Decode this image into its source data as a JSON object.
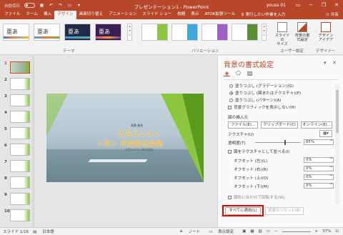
{
  "title_bar": {
    "autosave": "自動保存",
    "autosave_state": "オフ",
    "doc_title": "プレゼンテーション1 - PowerPoint",
    "user": "yousa 01"
  },
  "tabs": {
    "items": [
      "ファイル",
      "ホーム",
      "挿入",
      "デザイン",
      "画面切り替え",
      "アニメーション",
      "スライド ショー",
      "校閲",
      "表示",
      "ATOK拡張ツール"
    ],
    "active": "デザイン",
    "search": "実行したい作業を入力",
    "share": "共有"
  },
  "ribbon": {
    "themes": [
      "亜あ",
      "亜あ",
      "亜あ",
      "亜あ"
    ],
    "group_theme": "テーマ",
    "group_variation": "バリエーション",
    "group_user": "ユーザー設定",
    "group_designer": "デザイナー",
    "btn_slide_size": "スライドの\nサイズ",
    "btn_bg_format": "背景の書\n式設定",
    "btn_design_idea": "デザイン\nアイデア"
  },
  "thumbnails": {
    "numbers": [
      "1",
      "2",
      "3",
      "4",
      "5",
      "6",
      "7",
      "8",
      "9",
      "10"
    ],
    "selected": "1"
  },
  "slide": {
    "title1": "大宮ユニオン",
    "title2": "＜年＞ 年度販売提案",
    "sub1": "発表 者名",
    "sub2": "大宮ユニオン株式会社"
  },
  "pane": {
    "title": "背景の書式設定",
    "opt_gradient": "塗りつぶし (グラデーション)(G)",
    "opt_picture": "塗りつぶし (図またはテクスチャ)(P)",
    "opt_pattern": "塗りつぶし (パターン)(A)",
    "chk_hide": "背景グラフィックを表示しない(H)",
    "insert_label": "図の挿入元",
    "btn_file": "ファイル(E)...",
    "btn_clip": "クリップボード(C)",
    "btn_online": "オンライン(E)...",
    "texture_label": "テクスチャ(U)",
    "transparency_label": "透明度(T)",
    "transparency_value": "65%",
    "transparency_fraction": 0.65,
    "chk_tile": "図をテクスチャとして並べる(I)",
    "offset_left": "オフセット (左)(L)",
    "offset_right": "オフセット (右)(R)",
    "offset_top": "オフセット (上)(O)",
    "offset_bottom": "オフセット (下)(M)",
    "offset_value": "0%",
    "chk_rotate": "図形に合わせて回転する(W)",
    "btn_apply_all": "すべてに適用(L)",
    "btn_reset": "背景のリセット(B)"
  },
  "status": {
    "slide": "スライド 1/16",
    "lang": "日本語",
    "notes": "ノート",
    "display": "表示設定",
    "zoom": "37%"
  }
}
